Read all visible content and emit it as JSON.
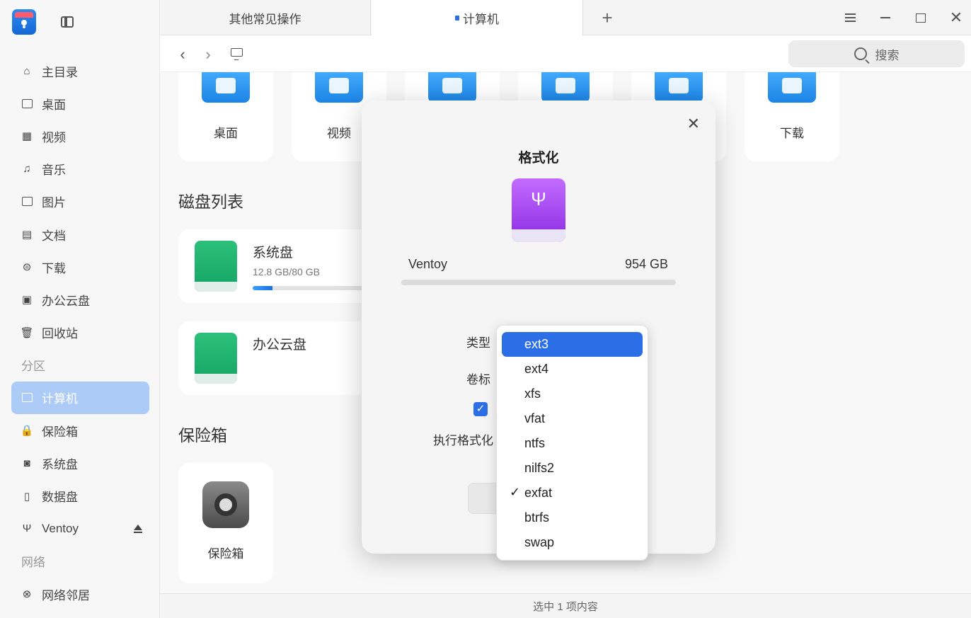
{
  "sidebar": {
    "items": [
      {
        "label": "主目录",
        "icon": "home-icon"
      },
      {
        "label": "桌面",
        "icon": "desktop-icon"
      },
      {
        "label": "视频",
        "icon": "video-icon"
      },
      {
        "label": "音乐",
        "icon": "music-icon"
      },
      {
        "label": "图片",
        "icon": "picture-icon"
      },
      {
        "label": "文档",
        "icon": "document-icon"
      },
      {
        "label": "下载",
        "icon": "download-icon"
      },
      {
        "label": "办公云盘",
        "icon": "cloud-drive-icon"
      },
      {
        "label": "回收站",
        "icon": "trash-icon"
      }
    ],
    "group_partition": "分区",
    "partition_items": [
      {
        "label": "计算机",
        "icon": "computer-icon",
        "active": true
      },
      {
        "label": "保险箱",
        "icon": "vault-icon"
      },
      {
        "label": "系统盘",
        "icon": "system-disk-icon"
      },
      {
        "label": "数据盘",
        "icon": "data-disk-icon"
      },
      {
        "label": "Ventoy",
        "icon": "usb-icon"
      }
    ],
    "group_network": "网络",
    "network_items": [
      {
        "label": "网络邻居",
        "icon": "network-icon"
      }
    ]
  },
  "tabs": [
    "其他常见操作",
    "计算机"
  ],
  "search": {
    "placeholder": "搜索"
  },
  "favorites": [
    "桌面",
    "视频",
    "",
    "",
    "",
    "下载"
  ],
  "sections": {
    "disks": "磁盘列表",
    "vault": "保险箱"
  },
  "disks": [
    {
      "name": "系统盘",
      "size": "12.8 GB/80 GB",
      "usage": 0.16
    },
    {
      "name": "办公云盘"
    }
  ],
  "vault_label": "保险箱",
  "statusbar": {
    "text": "选中 1 项内容"
  },
  "dialog": {
    "title": "格式化",
    "device_name": "Ventoy",
    "device_size": "954 GB",
    "type_label": "类型",
    "volume_label": "卷标",
    "checkbox_checked": true,
    "format_option_label": "执行格式化",
    "accent": "#2b6ee6"
  },
  "dropdown": {
    "options": [
      "ext3",
      "ext4",
      "xfs",
      "vfat",
      "ntfs",
      "nilfs2",
      "exfat",
      "btrfs",
      "swap"
    ],
    "highlighted": "ext3",
    "selected": "exfat"
  }
}
